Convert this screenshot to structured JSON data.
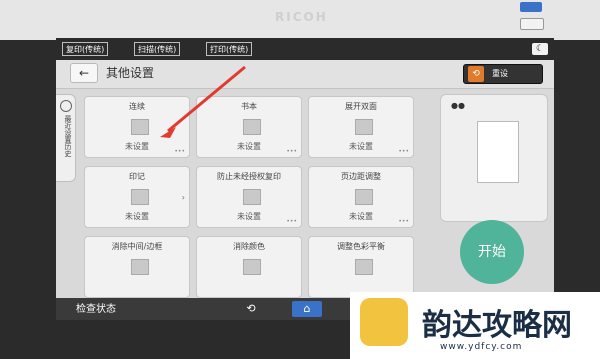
{
  "device": {
    "brand": "RICOH"
  },
  "app_tabs": [
    {
      "label": "复印(传统)"
    },
    {
      "label": "扫描(传统)"
    },
    {
      "label": "打印(传统)"
    }
  ],
  "header": {
    "title": "其他设置",
    "reset_label": "重设"
  },
  "side_tab": {
    "label": "最近设置历史"
  },
  "tiles": [
    {
      "title": "连续",
      "status": "未设置"
    },
    {
      "title": "书本",
      "status": "未设置"
    },
    {
      "title": "展开双面",
      "status": "未设置"
    },
    {
      "title": "印记",
      "status": "未设置"
    },
    {
      "title": "防止未经授权复印",
      "status": "未设置"
    },
    {
      "title": "页边距调整",
      "status": "未设置"
    },
    {
      "title": "消除中间/边框",
      "status": ""
    },
    {
      "title": "消除颜色",
      "status": ""
    },
    {
      "title": "调整色彩平衡",
      "status": ""
    }
  ],
  "start_label": "开始",
  "bottom": {
    "status_check": "检查状态"
  },
  "watermark": {
    "text": "韵达攻略网",
    "url": "www.ydfcy.com"
  },
  "colors": {
    "accent": "#3a72c8",
    "start": "#4fb49a",
    "reset_icon": "#e07a2d",
    "annotation_arrow": "#e23b2e"
  },
  "icons": {
    "back": "arrow-left-icon",
    "reset": "reset-icon",
    "history": "clock-icon",
    "return": "return-icon",
    "home": "home-icon"
  }
}
